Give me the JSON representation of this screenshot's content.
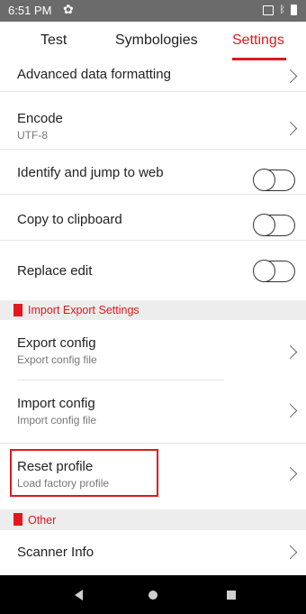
{
  "status_bar": {
    "time": "6:51 PM",
    "settings_icon": "gear-icon",
    "icons": [
      "screenshot-icon",
      "bluetooth-icon",
      "battery-icon"
    ]
  },
  "tabs": [
    {
      "label": "Test",
      "active": false
    },
    {
      "label": "Symbologies",
      "active": false
    },
    {
      "label": "Settings",
      "active": true
    }
  ],
  "accent_color": "#e0191f",
  "rows": {
    "advanced_data_formatting": {
      "title": "Advanced data formatting"
    },
    "encode": {
      "title": "Encode",
      "subtitle": "UTF-8"
    },
    "identify_jump_web": {
      "title": "Identify and jump to web",
      "toggle": false
    },
    "copy_clipboard": {
      "title": "Copy to clipboard",
      "toggle": false
    },
    "replace_edit": {
      "title": "Replace edit",
      "toggle": false
    },
    "export_config": {
      "title": "Export config",
      "subtitle": "Export config file"
    },
    "import_config": {
      "title": "Import config",
      "subtitle": "Import config file"
    },
    "reset_profile": {
      "title": "Reset profile",
      "subtitle": "Load factory profile"
    },
    "scanner_info": {
      "title": "Scanner Info"
    }
  },
  "sections": {
    "import_export": "Import Export Settings",
    "other": "Other"
  },
  "nav_bar": {
    "icons": [
      "back-icon",
      "home-icon",
      "recents-icon"
    ]
  }
}
